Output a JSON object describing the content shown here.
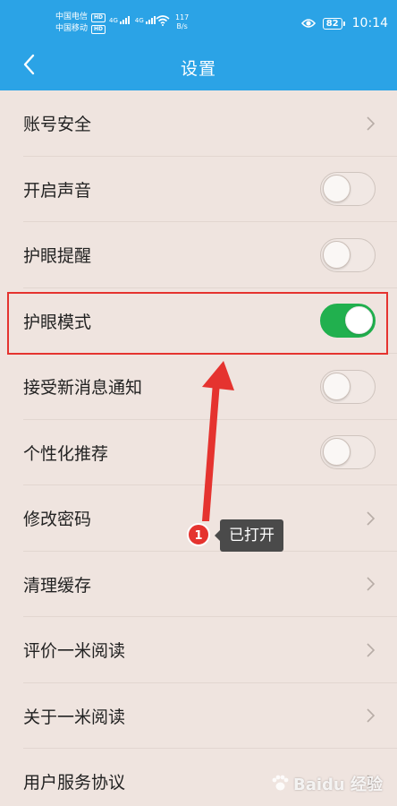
{
  "status_bar": {
    "carrier_1": "中国电信",
    "carrier_2": "中国移动",
    "hd_badge": "HD",
    "network_1": "4G",
    "network_2": "4G",
    "speed_value": "117",
    "speed_unit": "B/s",
    "battery": "82",
    "time": "10:14"
  },
  "header": {
    "title": "设置",
    "back_icon": "chevron-left-icon"
  },
  "settings": {
    "items": [
      {
        "label": "账号安全",
        "control": "chevron"
      },
      {
        "label": "开启声音",
        "control": "toggle",
        "on": false
      },
      {
        "label": "护眼提醒",
        "control": "toggle",
        "on": false
      },
      {
        "label": "护眼模式",
        "control": "toggle",
        "on": true
      },
      {
        "label": "接受新消息通知",
        "control": "toggle",
        "on": false
      },
      {
        "label": "个性化推荐",
        "control": "toggle",
        "on": false
      },
      {
        "label": "修改密码",
        "control": "chevron"
      },
      {
        "label": "清理缓存",
        "control": "chevron"
      },
      {
        "label": "评价一米阅读",
        "control": "chevron"
      },
      {
        "label": "关于一米阅读",
        "control": "chevron"
      },
      {
        "label": "用户服务协议",
        "control": "chevron"
      }
    ]
  },
  "annotation": {
    "step_number": "1",
    "tip_text": "已打开",
    "highlight_color": "#e5332f"
  },
  "watermark": {
    "text": "Baidu 经验"
  },
  "colors": {
    "header_bg": "#2ba3e6",
    "toggle_on": "#21b04e",
    "page_bg": "#efe4df"
  }
}
